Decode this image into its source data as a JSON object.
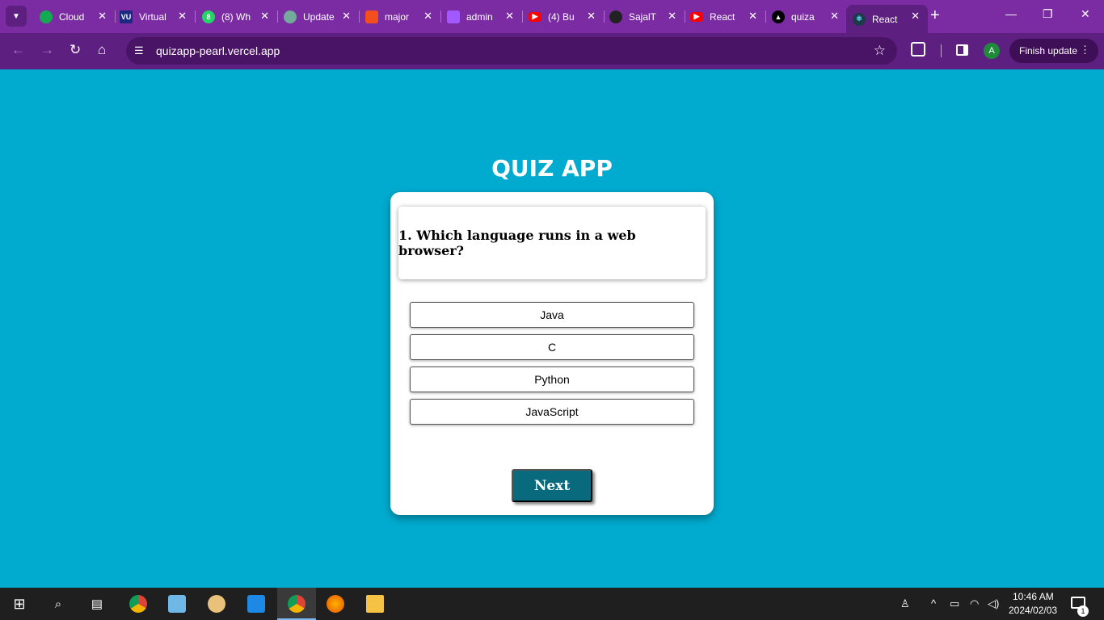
{
  "browser": {
    "tabs": [
      {
        "title": "Cloud",
        "icon": "mongodb-icon",
        "color": "#13aa52"
      },
      {
        "title": "Virtual",
        "icon": "vu-logo-icon",
        "color": "#1b2a80"
      },
      {
        "title": "(8) Wh",
        "icon": "whatsapp-icon",
        "color": "#25d366"
      },
      {
        "title": "Update",
        "icon": "chatgpt-icon",
        "color": "#74aa9c"
      },
      {
        "title": "major",
        "icon": "figma-icon",
        "color": "#f24e1e"
      },
      {
        "title": "admin",
        "icon": "figma-icon",
        "color": "#a259ff"
      },
      {
        "title": "(4) Bu",
        "icon": "youtube-icon",
        "color": "#ff0000"
      },
      {
        "title": "SajalT",
        "icon": "github-icon",
        "color": "#222222"
      },
      {
        "title": "React",
        "icon": "youtube-icon",
        "color": "#ff0000"
      },
      {
        "title": "quiza",
        "icon": "vercel-icon",
        "color": "#000000"
      },
      {
        "title": "React",
        "icon": "react-icon",
        "color": "#61dafb",
        "active": true
      }
    ],
    "url": "quizapp-pearl.vercel.app",
    "profile_initial": "A",
    "finish_update_label": "Finish update"
  },
  "quiz": {
    "title": "QUIZ APP",
    "question": "1. Which language runs in a web browser?",
    "options": [
      "Java",
      "C",
      "Python",
      "JavaScript"
    ],
    "next_label": "Next"
  },
  "taskbar": {
    "time": "10:46 AM",
    "date": "2024/02/03",
    "notification_count": "1",
    "pinned": [
      "windows-start-icon",
      "search-icon",
      "task-view-icon",
      "chrome-icon",
      "notepad-icon",
      "paint-icon",
      "vscode-icon",
      "chrome-profile-icon",
      "firefox-icon",
      "file-explorer-icon"
    ]
  },
  "colors": {
    "page_background": "#00abcf",
    "tabstrip": "#7b2ca3",
    "toolbar": "#5d1f80",
    "next_button": "#0a6a7d"
  }
}
